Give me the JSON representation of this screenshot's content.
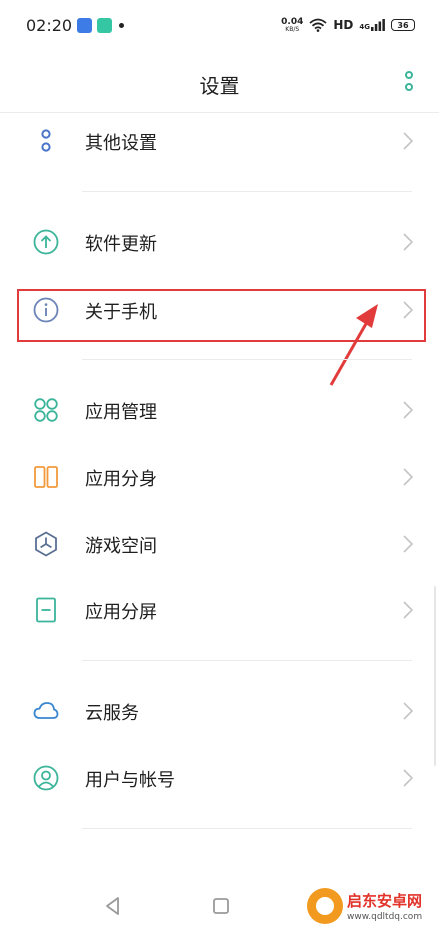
{
  "status_bar": {
    "time": "02:20",
    "net_speed_value": "0.04",
    "net_speed_unit": "KB/S",
    "hd_label": "HD",
    "signal_label": "4G",
    "battery_level": "36"
  },
  "header": {
    "title": "设置"
  },
  "rows": [
    {
      "label": "其他设置"
    },
    {
      "label": "软件更新"
    },
    {
      "label": "关于手机"
    },
    {
      "label": "应用管理"
    },
    {
      "label": "应用分身"
    },
    {
      "label": "游戏空间"
    },
    {
      "label": "应用分屏"
    },
    {
      "label": "云服务"
    },
    {
      "label": "用户与帐号"
    }
  ],
  "colors": {
    "icon_accent": "#3bb59a",
    "highlight": "#e23b3b",
    "clone_orange": "#f29a3b"
  },
  "watermark": {
    "title": "启东安卓网",
    "url": "www.qdltdq.com"
  }
}
